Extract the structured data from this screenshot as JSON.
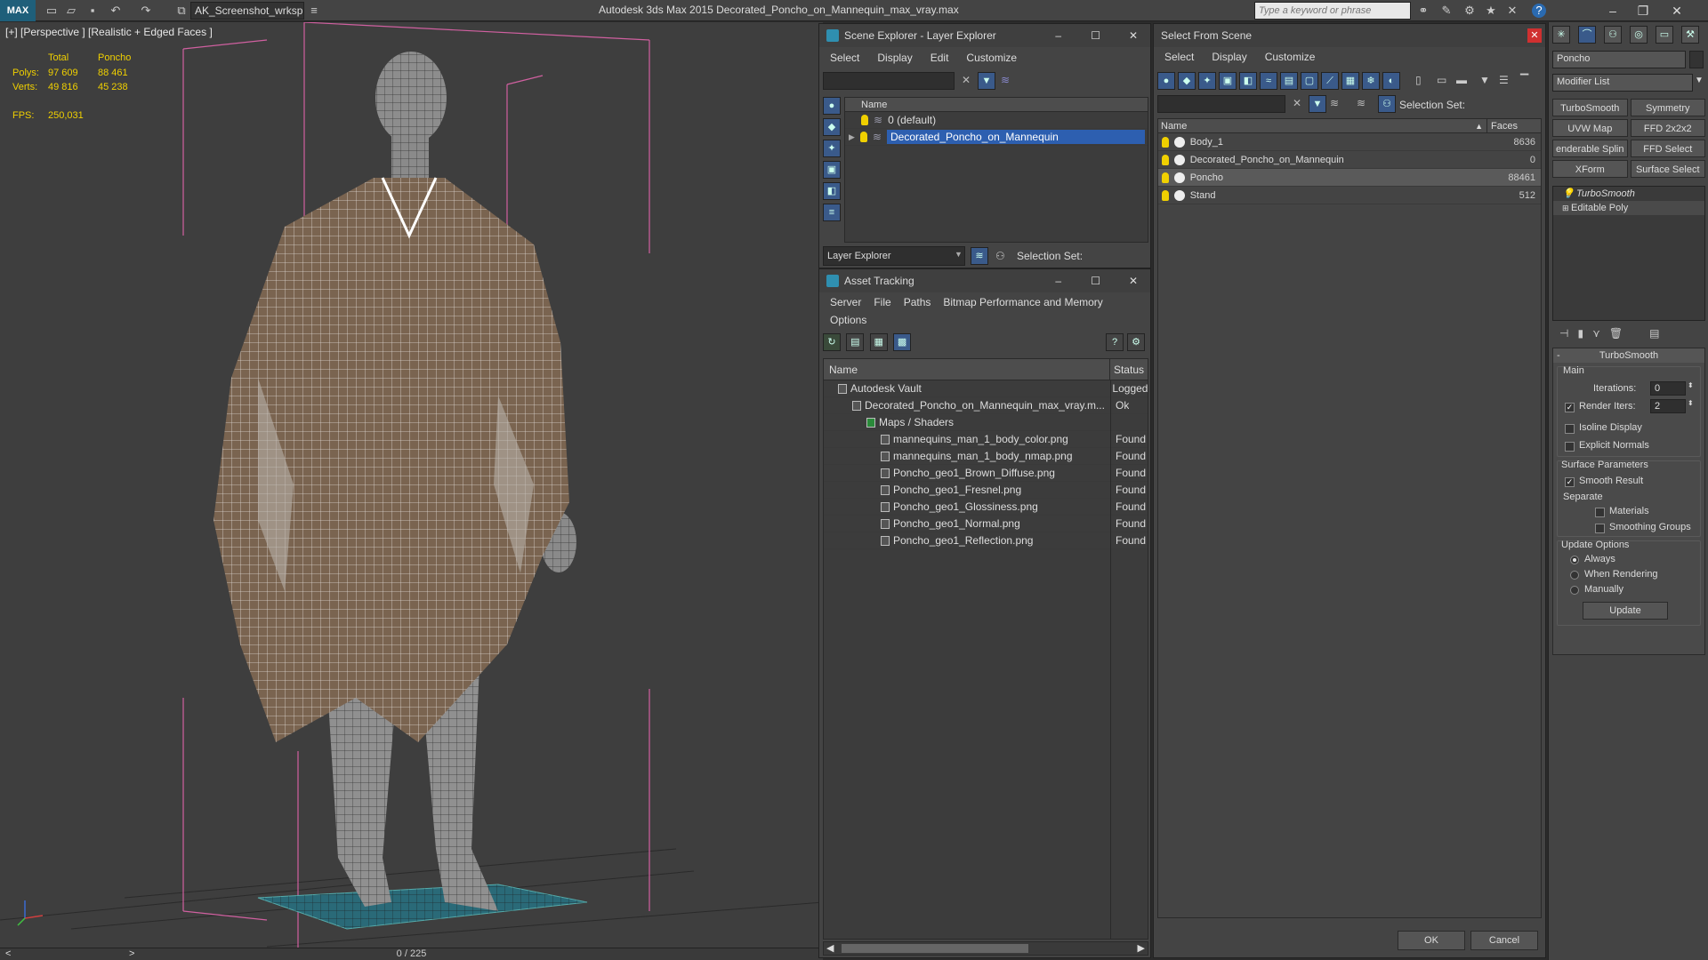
{
  "app": {
    "logo": "MAX",
    "workspace": "AK_Screenshot_wrksp",
    "title": "Autodesk 3ds Max  2015    Decorated_Poncho_on_Mannequin_max_vray.max",
    "search_placeholder": "Type a keyword or phrase"
  },
  "viewport": {
    "label": "[+] [Perspective ] [Realistic + Edged Faces ]",
    "stats": {
      "col_total": "Total",
      "col_poncho": "Poncho",
      "polys_label": "Polys:",
      "polys_total": "97 609",
      "polys_poncho": "88 461",
      "verts_label": "Verts:",
      "verts_total": "49 816",
      "verts_poncho": "45 238",
      "fps_label": "FPS:",
      "fps_value": "250,031"
    },
    "timeline": {
      "frame": "0 / 225",
      "prev": "<",
      "next": ">"
    }
  },
  "scene_explorer": {
    "title": "Scene Explorer - Layer Explorer",
    "menu": [
      "Select",
      "Display",
      "Edit",
      "Customize"
    ],
    "col_name": "Name",
    "layers": [
      {
        "name": "0 (default)",
        "selected": false
      },
      {
        "name": "Decorated_Poncho_on_Mannequin",
        "selected": true
      }
    ],
    "footer_dropdown": "Layer Explorer",
    "selection_set_label": "Selection Set:"
  },
  "asset_tracking": {
    "title": "Asset Tracking",
    "menu": [
      "Server",
      "File",
      "Paths",
      "Bitmap Performance and Memory"
    ],
    "menu2": "Options",
    "col_name": "Name",
    "col_status": "Status",
    "rows": [
      {
        "name": "Autodesk Vault",
        "status": "Logged",
        "indent": 1
      },
      {
        "name": "Decorated_Poncho_on_Mannequin_max_vray.m...",
        "status": "Ok",
        "indent": 2
      },
      {
        "name": "Maps / Shaders",
        "status": "",
        "indent": 3
      },
      {
        "name": "mannequins_man_1_body_color.png",
        "status": "Found",
        "indent": 4
      },
      {
        "name": "mannequins_man_1_body_nmap.png",
        "status": "Found",
        "indent": 4
      },
      {
        "name": "Poncho_geo1_Brown_Diffuse.png",
        "status": "Found",
        "indent": 4
      },
      {
        "name": "Poncho_geo1_Fresnel.png",
        "status": "Found",
        "indent": 4
      },
      {
        "name": "Poncho_geo1_Glossiness.png",
        "status": "Found",
        "indent": 4
      },
      {
        "name": "Poncho_geo1_Normal.png",
        "status": "Found",
        "indent": 4
      },
      {
        "name": "Poncho_geo1_Reflection.png",
        "status": "Found",
        "indent": 4
      }
    ]
  },
  "select_from_scene": {
    "title": "Select From Scene",
    "menu": [
      "Select",
      "Display",
      "Customize"
    ],
    "selection_set_label": "Selection Set:",
    "col_name": "Name",
    "col_faces": "Faces",
    "rows": [
      {
        "name": "Body_1",
        "faces": "8636",
        "selected": false
      },
      {
        "name": "Decorated_Poncho_on_Mannequin",
        "faces": "0",
        "selected": false
      },
      {
        "name": "Poncho",
        "faces": "88461",
        "selected": true
      },
      {
        "name": "Stand",
        "faces": "512",
        "selected": false
      }
    ],
    "ok": "OK",
    "cancel": "Cancel"
  },
  "modify_panel": {
    "object_name": "Poncho",
    "modifier_list": "Modifier List",
    "buttons": [
      "TurboSmooth",
      "Symmetry",
      "UVW Map",
      "FFD 2x2x2",
      "enderable Splin",
      "FFD Select",
      "XForm",
      "Surface Select"
    ],
    "stack": [
      "TurboSmooth",
      "Editable Poly"
    ],
    "rollout_title": "TurboSmooth",
    "main_label": "Main",
    "iterations_label": "Iterations:",
    "iterations_value": "0",
    "render_iters_label": "Render Iters:",
    "render_iters_value": "2",
    "isoline": "Isoline Display",
    "explicit_normals": "Explicit Normals",
    "surface_params": "Surface Parameters",
    "smooth_result": "Smooth Result",
    "separate": "Separate",
    "materials": "Materials",
    "smoothing_groups": "Smoothing Groups",
    "update_options": "Update Options",
    "always": "Always",
    "when_rendering": "When Rendering",
    "manually": "Manually",
    "update": "Update"
  }
}
